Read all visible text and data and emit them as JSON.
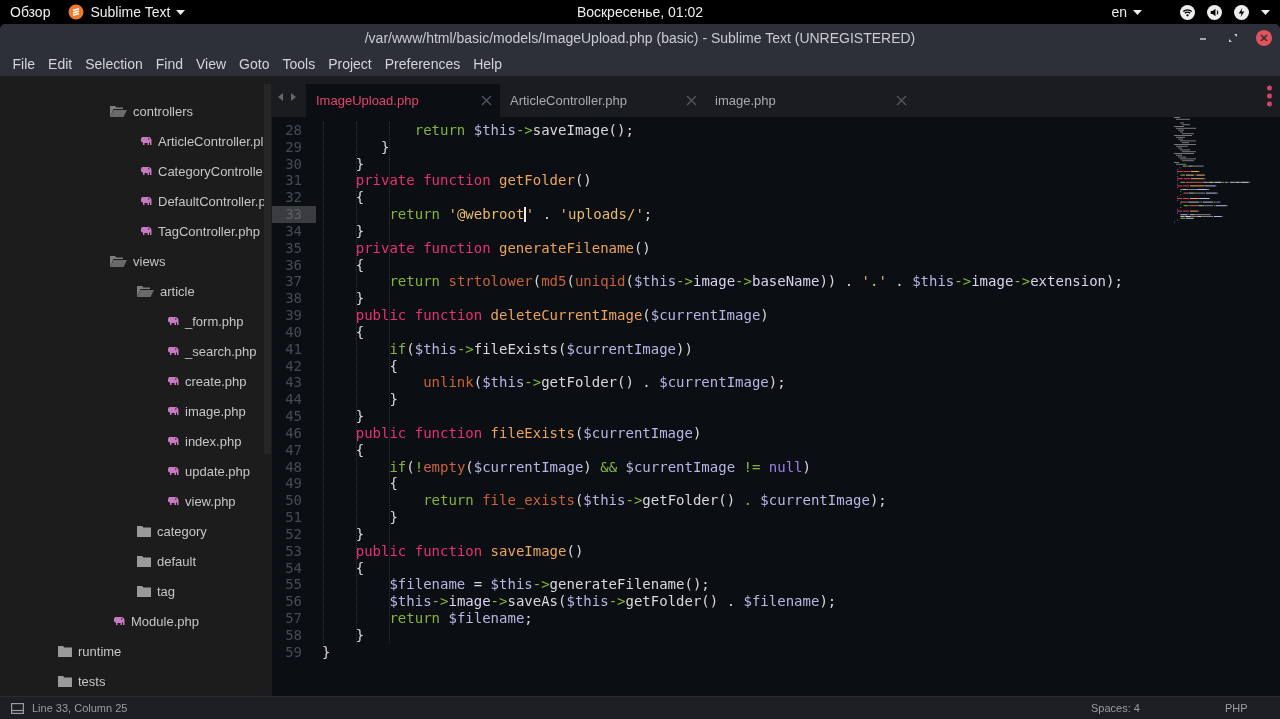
{
  "top_bar": {
    "activities": "Обзор",
    "app_menu": "Sublime Text",
    "clock": "Воскресенье, 01:02",
    "language": "en"
  },
  "window": {
    "title": "/var/www/html/basic/models/ImageUpload.php (basic) - Sublime Text (UNREGISTERED)"
  },
  "menu": [
    "File",
    "Edit",
    "Selection",
    "Find",
    "View",
    "Goto",
    "Tools",
    "Project",
    "Preferences",
    "Help"
  ],
  "sidebar": {
    "sections": [
      {
        "kind": "nested",
        "items": [
          {
            "label": "controllers",
            "kind": "folder",
            "expanded": true,
            "children": [
              {
                "label": "ArticleController.pl",
                "kind": "file"
              },
              {
                "label": "CategoryControlle",
                "kind": "file"
              },
              {
                "label": "DefaultController.p",
                "kind": "file"
              },
              {
                "label": "TagController.php",
                "kind": "file"
              }
            ]
          },
          {
            "label": "views",
            "kind": "folder",
            "expanded": true,
            "children": [
              {
                "label": "article",
                "kind": "folder",
                "expanded": true,
                "children": [
                  {
                    "label": "_form.php",
                    "kind": "file"
                  },
                  {
                    "label": "_search.php",
                    "kind": "file"
                  },
                  {
                    "label": "create.php",
                    "kind": "file"
                  },
                  {
                    "label": "image.php",
                    "kind": "file"
                  },
                  {
                    "label": "index.php",
                    "kind": "file"
                  },
                  {
                    "label": "update.php",
                    "kind": "file"
                  },
                  {
                    "label": "view.php",
                    "kind": "file"
                  }
                ]
              },
              {
                "label": "category",
                "kind": "folder",
                "expanded": false
              },
              {
                "label": "default",
                "kind": "folder",
                "expanded": false
              },
              {
                "label": "tag",
                "kind": "folder",
                "expanded": false
              }
            ]
          },
          {
            "label": "Module.php",
            "kind": "file"
          }
        ]
      },
      {
        "kind": "root",
        "items": [
          {
            "label": "runtime",
            "kind": "folder",
            "expanded": false
          },
          {
            "label": "tests",
            "kind": "folder",
            "expanded": false
          }
        ]
      }
    ]
  },
  "tabs": [
    {
      "label": "ImageUpload.php",
      "selected": true
    },
    {
      "label": "ArticleController.php",
      "selected": false
    },
    {
      "label": "image.php",
      "selected": false
    }
  ],
  "editor": {
    "lines": [
      {
        "number": "28",
        "current": false,
        "tokens": [
          {
            "kind": "control",
            "text": "           return "
          },
          {
            "kind": "variable",
            "text": "$this"
          },
          {
            "kind": "operator",
            "text": "->"
          },
          {
            "kind": "plain",
            "text": "saveImage();"
          }
        ]
      },
      {
        "number": "29",
        "current": false,
        "tokens": [
          {
            "kind": "plain",
            "text": "       }"
          }
        ]
      },
      {
        "number": "30",
        "current": false,
        "tokens": [
          {
            "kind": "plain",
            "text": "    }"
          }
        ]
      },
      {
        "number": "31",
        "current": false,
        "tokens": [
          {
            "kind": "keyword",
            "text": "    private "
          },
          {
            "kind": "storage",
            "text": "function "
          },
          {
            "kind": "function",
            "text": "getFolder"
          },
          {
            "kind": "plain",
            "text": "()"
          }
        ]
      },
      {
        "number": "32",
        "current": false,
        "tokens": [
          {
            "kind": "plain",
            "text": "    {"
          }
        ]
      },
      {
        "number": "33",
        "current": true,
        "tokens": [
          {
            "kind": "control",
            "text": "        return "
          },
          {
            "kind": "string",
            "text": "'@webroot"
          },
          {
            "kind": "cursor"
          },
          {
            "kind": "string",
            "text": "'"
          },
          {
            "kind": "plain",
            "text": " . "
          },
          {
            "kind": "string",
            "text": "'uploads/'"
          },
          {
            "kind": "plain",
            "text": ";"
          }
        ]
      },
      {
        "number": "34",
        "current": false,
        "tokens": [
          {
            "kind": "plain",
            "text": "    }"
          }
        ]
      },
      {
        "number": "35",
        "current": false,
        "tokens": [
          {
            "kind": "keyword",
            "text": "    private "
          },
          {
            "kind": "storage",
            "text": "function "
          },
          {
            "kind": "function",
            "text": "generateFilename"
          },
          {
            "kind": "plain",
            "text": "()"
          }
        ]
      },
      {
        "number": "36",
        "current": false,
        "tokens": [
          {
            "kind": "plain",
            "text": "    {"
          }
        ]
      },
      {
        "number": "37",
        "current": false,
        "tokens": [
          {
            "kind": "control",
            "text": "        return "
          },
          {
            "kind": "builtin",
            "text": "strtolower"
          },
          {
            "kind": "plain",
            "text": "("
          },
          {
            "kind": "builtin",
            "text": "md5"
          },
          {
            "kind": "plain",
            "text": "("
          },
          {
            "kind": "builtin",
            "text": "uniqid"
          },
          {
            "kind": "plain",
            "text": "("
          },
          {
            "kind": "variable",
            "text": "$this"
          },
          {
            "kind": "operator",
            "text": "->"
          },
          {
            "kind": "property",
            "text": "image"
          },
          {
            "kind": "operator",
            "text": "->"
          },
          {
            "kind": "property",
            "text": "baseName"
          },
          {
            "kind": "plain",
            "text": ")) . "
          },
          {
            "kind": "string",
            "text": "'.'"
          },
          {
            "kind": "plain",
            "text": " . "
          },
          {
            "kind": "variable",
            "text": "$this"
          },
          {
            "kind": "operator",
            "text": "->"
          },
          {
            "kind": "property",
            "text": "image"
          },
          {
            "kind": "operator",
            "text": "->"
          },
          {
            "kind": "property",
            "text": "extension"
          },
          {
            "kind": "plain",
            "text": ");"
          }
        ]
      },
      {
        "number": "38",
        "current": false,
        "tokens": [
          {
            "kind": "plain",
            "text": "    }"
          }
        ]
      },
      {
        "number": "39",
        "current": false,
        "tokens": [
          {
            "kind": "keyword",
            "text": "    public "
          },
          {
            "kind": "storage",
            "text": "function "
          },
          {
            "kind": "function",
            "text": "deleteCurrentImage"
          },
          {
            "kind": "plain",
            "text": "("
          },
          {
            "kind": "variable",
            "text": "$currentImage"
          },
          {
            "kind": "plain",
            "text": ")"
          }
        ]
      },
      {
        "number": "40",
        "current": false,
        "tokens": [
          {
            "kind": "plain",
            "text": "    {"
          }
        ]
      },
      {
        "number": "41",
        "current": false,
        "tokens": [
          {
            "kind": "control",
            "text": "        if"
          },
          {
            "kind": "plain",
            "text": "("
          },
          {
            "kind": "variable",
            "text": "$this"
          },
          {
            "kind": "operator",
            "text": "->"
          },
          {
            "kind": "plain",
            "text": "fileExists("
          },
          {
            "kind": "variable",
            "text": "$currentImage"
          },
          {
            "kind": "plain",
            "text": "))"
          }
        ]
      },
      {
        "number": "42",
        "current": false,
        "tokens": [
          {
            "kind": "plain",
            "text": "        {"
          }
        ]
      },
      {
        "number": "43",
        "current": false,
        "tokens": [
          {
            "kind": "builtin",
            "text": "            unlink"
          },
          {
            "kind": "plain",
            "text": "("
          },
          {
            "kind": "variable",
            "text": "$this"
          },
          {
            "kind": "operator",
            "text": "->"
          },
          {
            "kind": "plain",
            "text": "getFolder() . "
          },
          {
            "kind": "variable",
            "text": "$currentImage"
          },
          {
            "kind": "plain",
            "text": ");"
          }
        ]
      },
      {
        "number": "44",
        "current": false,
        "tokens": [
          {
            "kind": "plain",
            "text": "        }"
          }
        ]
      },
      {
        "number": "45",
        "current": false,
        "tokens": [
          {
            "kind": "plain",
            "text": "    }"
          }
        ]
      },
      {
        "number": "46",
        "current": false,
        "tokens": [
          {
            "kind": "keyword",
            "text": "    public "
          },
          {
            "kind": "storage",
            "text": "function "
          },
          {
            "kind": "function",
            "text": "fileExists"
          },
          {
            "kind": "plain",
            "text": "("
          },
          {
            "kind": "variable",
            "text": "$currentImage"
          },
          {
            "kind": "plain",
            "text": ")"
          }
        ]
      },
      {
        "number": "47",
        "current": false,
        "tokens": [
          {
            "kind": "plain",
            "text": "    {"
          }
        ]
      },
      {
        "number": "48",
        "current": false,
        "tokens": [
          {
            "kind": "control",
            "text": "        if"
          },
          {
            "kind": "plain",
            "text": "("
          },
          {
            "kind": "operator",
            "text": "!"
          },
          {
            "kind": "builtin",
            "text": "empty"
          },
          {
            "kind": "plain",
            "text": "("
          },
          {
            "kind": "variable",
            "text": "$currentImage"
          },
          {
            "kind": "plain",
            "text": ") "
          },
          {
            "kind": "operator",
            "text": "&& "
          },
          {
            "kind": "variable",
            "text": "$currentImage "
          },
          {
            "kind": "operator",
            "text": "!= "
          },
          {
            "kind": "constant",
            "text": "null"
          },
          {
            "kind": "plain",
            "text": ")"
          }
        ]
      },
      {
        "number": "49",
        "current": false,
        "tokens": [
          {
            "kind": "plain",
            "text": "        {"
          }
        ]
      },
      {
        "number": "50",
        "current": false,
        "tokens": [
          {
            "kind": "control",
            "text": "            return "
          },
          {
            "kind": "builtin",
            "text": "file_exists"
          },
          {
            "kind": "plain",
            "text": "("
          },
          {
            "kind": "variable",
            "text": "$this"
          },
          {
            "kind": "operator",
            "text": "->"
          },
          {
            "kind": "plain",
            "text": "getFolder() "
          },
          {
            "kind": "operator",
            "text": ". "
          },
          {
            "kind": "variable",
            "text": "$currentImage"
          },
          {
            "kind": "plain",
            "text": ");"
          }
        ]
      },
      {
        "number": "51",
        "current": false,
        "tokens": [
          {
            "kind": "plain",
            "text": "        }"
          }
        ]
      },
      {
        "number": "52",
        "current": false,
        "tokens": [
          {
            "kind": "plain",
            "text": "    }"
          }
        ]
      },
      {
        "number": "53",
        "current": false,
        "tokens": [
          {
            "kind": "keyword",
            "text": "    public "
          },
          {
            "kind": "storage",
            "text": "function "
          },
          {
            "kind": "function",
            "text": "saveImage"
          },
          {
            "kind": "plain",
            "text": "()"
          }
        ]
      },
      {
        "number": "54",
        "current": false,
        "tokens": [
          {
            "kind": "plain",
            "text": "    {"
          }
        ]
      },
      {
        "number": "55",
        "current": false,
        "tokens": [
          {
            "kind": "variable",
            "text": "        $filename"
          },
          {
            "kind": "plain",
            "text": " = "
          },
          {
            "kind": "variable",
            "text": "$this"
          },
          {
            "kind": "operator",
            "text": "->"
          },
          {
            "kind": "plain",
            "text": "generateFilename();"
          }
        ]
      },
      {
        "number": "56",
        "current": false,
        "tokens": [
          {
            "kind": "variable",
            "text": "        $this"
          },
          {
            "kind": "operator",
            "text": "->"
          },
          {
            "kind": "property",
            "text": "image"
          },
          {
            "kind": "operator",
            "text": "->"
          },
          {
            "kind": "plain",
            "text": "saveAs("
          },
          {
            "kind": "variable",
            "text": "$this"
          },
          {
            "kind": "operator",
            "text": "->"
          },
          {
            "kind": "plain",
            "text": "getFolder() . "
          },
          {
            "kind": "variable",
            "text": "$filename"
          },
          {
            "kind": "plain",
            "text": ");"
          }
        ]
      },
      {
        "number": "57",
        "current": false,
        "tokens": [
          {
            "kind": "control",
            "text": "        return "
          },
          {
            "kind": "variable",
            "text": "$filename"
          },
          {
            "kind": "plain",
            "text": ";"
          }
        ]
      },
      {
        "number": "58",
        "current": false,
        "tokens": [
          {
            "kind": "plain",
            "text": "    }"
          }
        ]
      },
      {
        "number": "59",
        "current": false,
        "tokens": [
          {
            "kind": "plain",
            "text": "}"
          }
        ]
      }
    ]
  },
  "status_bar": {
    "position": "Line 33, Column 25",
    "indentation": "Spaces: 4",
    "syntax": "PHP"
  }
}
